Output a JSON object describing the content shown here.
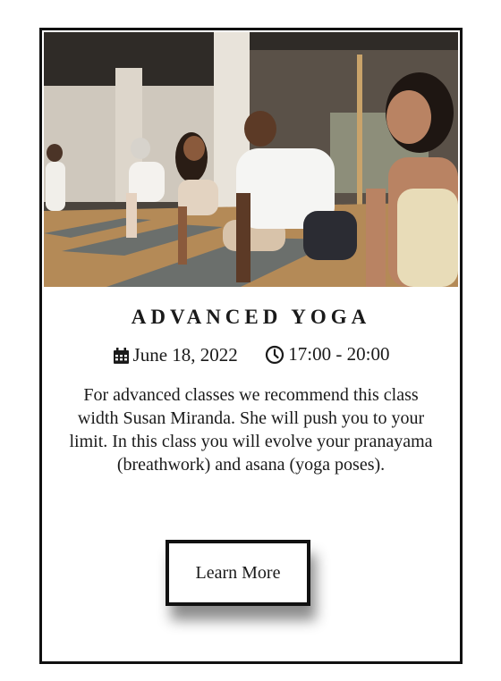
{
  "card": {
    "image_alt": "Group yoga class in upward dog pose",
    "title": "ADVANCED YOGA",
    "date": "June 18, 2022",
    "time": "17:00 - 20:00",
    "description": "For advanced classes we recommend this class width Susan Miranda. She will push you to your limit. In this class you will evolve your pranayama (breathwork) and asana (yoga poses).",
    "button_label": "Learn More"
  },
  "icons": {
    "date": "calendar-icon",
    "time": "clock-icon"
  },
  "colors": {
    "border": "#111111",
    "text": "#1a1a1a",
    "background": "#ffffff"
  }
}
